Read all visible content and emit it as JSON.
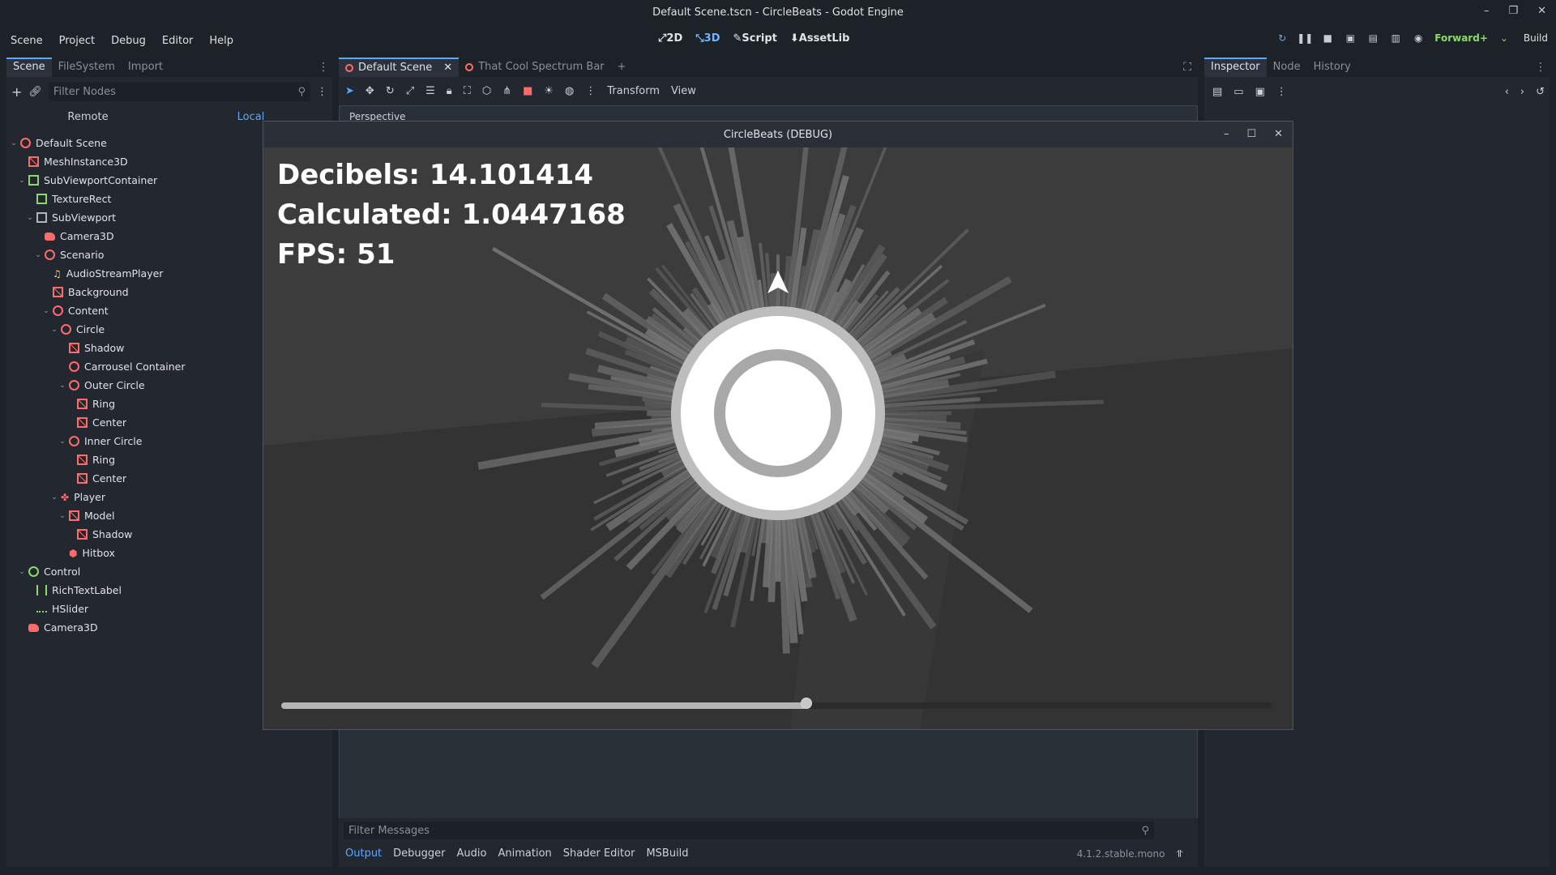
{
  "window": {
    "title": "Default Scene.tscn - CircleBeats - Godot Engine"
  },
  "menu": [
    "Scene",
    "Project",
    "Debug",
    "Editor",
    "Help"
  ],
  "modes": [
    {
      "label": "2D",
      "icon": "2d-icon",
      "active": false
    },
    {
      "label": "3D",
      "icon": "3d-icon",
      "active": true
    },
    {
      "label": "Script",
      "icon": "script-icon",
      "active": false
    },
    {
      "label": "AssetLib",
      "icon": "assetlib-icon",
      "active": false
    }
  ],
  "run": {
    "renderer": "Forward+",
    "build": "Build"
  },
  "left_dock": {
    "tabs": [
      "Scene",
      "FileSystem",
      "Import"
    ],
    "filter_placeholder": "Filter Nodes",
    "remote": "Remote",
    "local": "Local",
    "tree": [
      {
        "label": "Default Scene",
        "depth": 0,
        "icon": "node3d-icon",
        "expanded": true
      },
      {
        "label": "MeshInstance3D",
        "depth": 1,
        "icon": "mesh-icon"
      },
      {
        "label": "SubViewportContainer",
        "depth": 1,
        "icon": "container-icon",
        "expanded": true
      },
      {
        "label": "TextureRect",
        "depth": 2,
        "icon": "texture-icon"
      },
      {
        "label": "SubViewport",
        "depth": 2,
        "icon": "viewport-icon",
        "expanded": true
      },
      {
        "label": "Camera3D",
        "depth": 3,
        "icon": "camera-icon"
      },
      {
        "label": "Scenario",
        "depth": 3,
        "icon": "node3d-icon",
        "expanded": true
      },
      {
        "label": "AudioStreamPlayer",
        "depth": 4,
        "icon": "audio-icon"
      },
      {
        "label": "Background",
        "depth": 4,
        "icon": "mesh-icon"
      },
      {
        "label": "Content",
        "depth": 4,
        "icon": "node3d-icon",
        "expanded": true
      },
      {
        "label": "Circle",
        "depth": 5,
        "icon": "node3d-icon",
        "expanded": true
      },
      {
        "label": "Shadow",
        "depth": 6,
        "icon": "mesh-icon"
      },
      {
        "label": "Carrousel Container",
        "depth": 6,
        "icon": "node3d-icon"
      },
      {
        "label": "Outer Circle",
        "depth": 6,
        "icon": "node3d-icon",
        "expanded": true
      },
      {
        "label": "Ring",
        "depth": 7,
        "icon": "mesh-icon"
      },
      {
        "label": "Center",
        "depth": 7,
        "icon": "mesh-icon"
      },
      {
        "label": "Inner Circle",
        "depth": 6,
        "icon": "node3d-icon",
        "expanded": true
      },
      {
        "label": "Ring",
        "depth": 7,
        "icon": "mesh-icon"
      },
      {
        "label": "Center",
        "depth": 7,
        "icon": "mesh-icon"
      },
      {
        "label": "Player",
        "depth": 5,
        "icon": "player-icon",
        "expanded": true
      },
      {
        "label": "Model",
        "depth": 6,
        "icon": "mesh-icon",
        "expanded": true
      },
      {
        "label": "Shadow",
        "depth": 7,
        "icon": "mesh-icon"
      },
      {
        "label": "Hitbox",
        "depth": 6,
        "icon": "hitbox-icon"
      },
      {
        "label": "Control",
        "depth": 1,
        "icon": "control-icon",
        "expanded": true
      },
      {
        "label": "RichTextLabel",
        "depth": 2,
        "icon": "richtext-icon"
      },
      {
        "label": "HSlider",
        "depth": 2,
        "icon": "slider-icon"
      },
      {
        "label": "Camera3D",
        "depth": 1,
        "icon": "camera-icon"
      }
    ]
  },
  "center": {
    "tabs": [
      {
        "label": "Default Scene",
        "active": true
      },
      {
        "label": "That Cool Spectrum Bar",
        "active": false
      }
    ],
    "toolbar_menus": [
      "Transform",
      "View"
    ],
    "viewport_label": "Perspective",
    "filter_messages_placeholder": "Filter Messages",
    "bottom_tabs": [
      "Output",
      "Debugger",
      "Audio",
      "Animation",
      "Shader Editor",
      "MSBuild"
    ],
    "version": "4.1.2.stable.mono"
  },
  "right_dock": {
    "tabs": [
      "Inspector",
      "Node",
      "History"
    ]
  },
  "debug_window": {
    "title": "CircleBeats (DEBUG)",
    "decibels": "Decibels: 14.101414",
    "calculated": "Calculated: 1.0447168",
    "fps": "FPS: 51",
    "slider_value": 0.53
  },
  "colors": {
    "accent": "#5aa7ff",
    "node_red": "#ff6b6b",
    "node_green": "#8cd96b",
    "renderer": "#8cd96b"
  }
}
